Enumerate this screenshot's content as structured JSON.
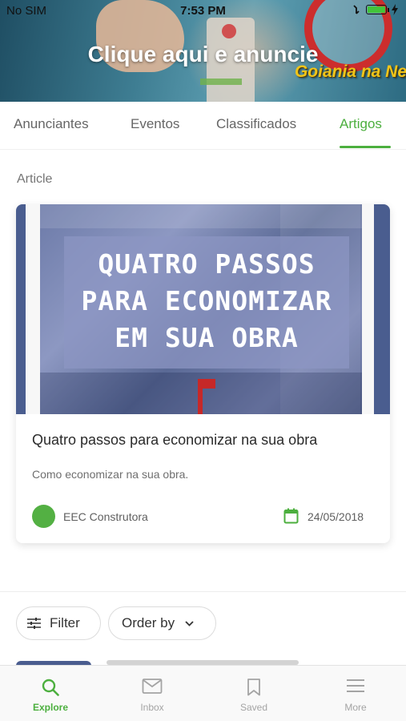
{
  "status_bar": {
    "carrier": "No SIM",
    "time": "7:53 PM"
  },
  "banner": {
    "title": "Clique aqui e anuncie",
    "brand": "Goiania na Net"
  },
  "tabs": [
    {
      "label": "Anunciantes",
      "active": false
    },
    {
      "label": "Eventos",
      "active": false
    },
    {
      "label": "Classificados",
      "active": false
    },
    {
      "label": "Artigos",
      "active": true
    }
  ],
  "section_label": "Article",
  "article": {
    "image_text": [
      "QUATRO PASSOS",
      "PARA ECONOMIZAR",
      "EM SUA OBRA"
    ],
    "title": "Quatro passos para economizar na sua obra",
    "subtitle": "Como economizar na sua obra.",
    "author": "EEC Construtora",
    "date": "24/05/2018"
  },
  "filter_bar": {
    "filter_label": "Filter",
    "order_label": "Order by"
  },
  "bottom_nav": [
    {
      "label": "Explore",
      "icon": "search-icon",
      "active": true
    },
    {
      "label": "Inbox",
      "icon": "mail-icon",
      "active": false
    },
    {
      "label": "Saved",
      "icon": "bookmark-icon",
      "active": false
    },
    {
      "label": "More",
      "icon": "menu-icon",
      "active": false
    }
  ],
  "colors": {
    "accent": "#4caf3e",
    "image_tint": "#4a5d8f"
  }
}
